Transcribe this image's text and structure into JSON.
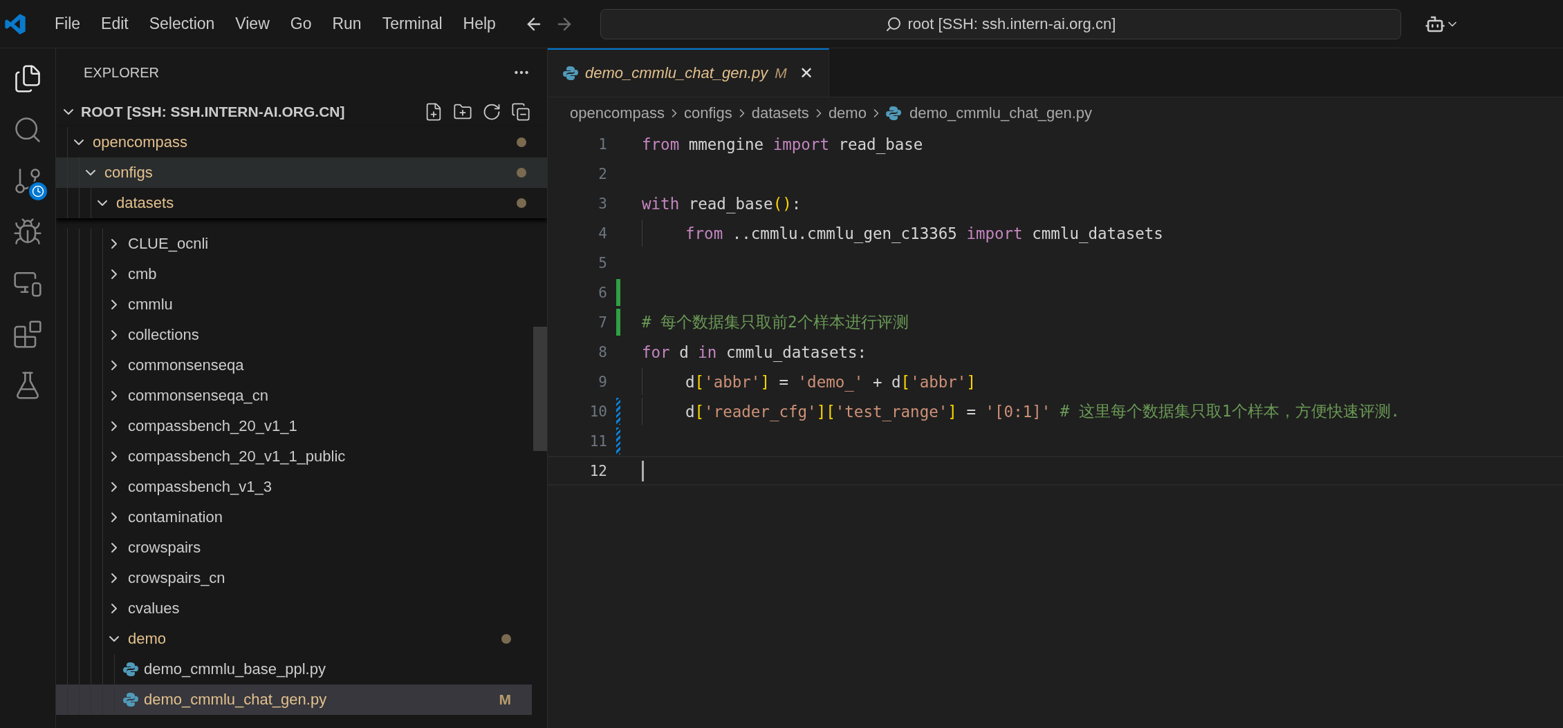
{
  "title_bar": {
    "menu": [
      "File",
      "Edit",
      "Selection",
      "View",
      "Go",
      "Run",
      "Terminal",
      "Help"
    ],
    "nav": [
      {
        "kind": "back",
        "disabled": false
      },
      {
        "kind": "forward",
        "disabled": true
      }
    ],
    "command_center": "root [SSH: ssh.intern-ai.org.cn]"
  },
  "activity_bar": [
    {
      "kind": "explorer",
      "selected": true
    },
    {
      "kind": "search",
      "selected": false
    },
    {
      "kind": "source-control",
      "selected": false
    },
    {
      "kind": "run",
      "selected": false
    },
    {
      "kind": "remote",
      "selected": false
    },
    {
      "kind": "extensions",
      "selected": false
    },
    {
      "kind": "testing",
      "selected": false
    }
  ],
  "sidebar": {
    "title": "EXPLORER",
    "root": "ROOT [SSH: SSH.INTERN-AI.ORG.CN]",
    "tree": [
      {
        "name": "opencompass",
        "kind": "folder",
        "expanded": true,
        "modified": true,
        "hovered": false,
        "selected": false,
        "children": [
          {
            "name": "configs",
            "kind": "folder",
            "expanded": true,
            "modified": true,
            "hovered": true,
            "selected": false,
            "children": [
              {
                "name": "datasets",
                "kind": "folder",
                "expanded": true,
                "modified": true,
                "hovered": false,
                "selected": false,
                "children": [
                  {
                    "name": "CLUE_ocnli",
                    "kind": "folder",
                    "expanded": false,
                    "modified": false,
                    "hovered": false,
                    "selected": false
                  },
                  {
                    "name": "cmb",
                    "kind": "folder",
                    "expanded": false,
                    "modified": false,
                    "hovered": false,
                    "selected": false
                  },
                  {
                    "name": "cmmlu",
                    "kind": "folder",
                    "expanded": false,
                    "modified": false,
                    "hovered": false,
                    "selected": false
                  },
                  {
                    "name": "collections",
                    "kind": "folder",
                    "expanded": false,
                    "modified": false,
                    "hovered": false,
                    "selected": false
                  },
                  {
                    "name": "commonsenseqa",
                    "kind": "folder",
                    "expanded": false,
                    "modified": false,
                    "hovered": false,
                    "selected": false
                  },
                  {
                    "name": "commonsenseqa_cn",
                    "kind": "folder",
                    "expanded": false,
                    "modified": false,
                    "hovered": false,
                    "selected": false
                  },
                  {
                    "name": "compassbench_20_v1_1",
                    "kind": "folder",
                    "expanded": false,
                    "modified": false,
                    "hovered": false,
                    "selected": false
                  },
                  {
                    "name": "compassbench_20_v1_1_public",
                    "kind": "folder",
                    "expanded": false,
                    "modified": false,
                    "hovered": false,
                    "selected": false
                  },
                  {
                    "name": "compassbench_v1_3",
                    "kind": "folder",
                    "expanded": false,
                    "modified": false,
                    "hovered": false,
                    "selected": false
                  },
                  {
                    "name": "contamination",
                    "kind": "folder",
                    "expanded": false,
                    "modified": false,
                    "hovered": false,
                    "selected": false
                  },
                  {
                    "name": "crowspairs",
                    "kind": "folder",
                    "expanded": false,
                    "modified": false,
                    "hovered": false,
                    "selected": false
                  },
                  {
                    "name": "crowspairs_cn",
                    "kind": "folder",
                    "expanded": false,
                    "modified": false,
                    "hovered": false,
                    "selected": false
                  },
                  {
                    "name": "cvalues",
                    "kind": "folder",
                    "expanded": false,
                    "modified": false,
                    "hovered": false,
                    "selected": false
                  },
                  {
                    "name": "demo",
                    "kind": "folder",
                    "expanded": true,
                    "modified": true,
                    "hovered": false,
                    "selected": false,
                    "children": [
                      {
                        "name": "demo_cmmlu_base_ppl.py",
                        "kind": "file",
                        "modified": false,
                        "hovered": false,
                        "selected": false
                      },
                      {
                        "name": "demo_cmmlu_chat_gen.py",
                        "kind": "file",
                        "modified": true,
                        "status": "M",
                        "hovered": false,
                        "selected": true
                      }
                    ]
                  }
                ]
              }
            ]
          }
        ]
      }
    ]
  },
  "editor": {
    "tab": {
      "title": "demo_cmmlu_chat_gen.py",
      "status": "M",
      "close": "✕",
      "selected": true
    },
    "breadcrumb": [
      "opencompass",
      "configs",
      "datasets",
      "demo",
      "demo_cmmlu_chat_gen.py"
    ],
    "lines": [
      {
        "number": "1",
        "current": false,
        "tokens": [
          {
            "kind": "keyword",
            "text": "from"
          },
          {
            "kind": "plain",
            "text": " mmengine "
          },
          {
            "kind": "keyword",
            "text": "import"
          },
          {
            "kind": "plain",
            "text": " read_base"
          }
        ]
      },
      {
        "number": "2",
        "current": false
      },
      {
        "number": "3",
        "current": false,
        "tokens": [
          {
            "kind": "keyword",
            "text": "with"
          },
          {
            "kind": "plain",
            "text": " read_base"
          },
          {
            "kind": "bracket",
            "text": "()"
          },
          {
            "kind": "plain",
            "text": ":"
          }
        ]
      },
      {
        "number": "4",
        "indented": true,
        "current": false,
        "tokens": [
          {
            "kind": "keyword",
            "text": "from"
          },
          {
            "kind": "plain",
            "text": " ..cmmlu.cmmlu_gen_c13365 "
          },
          {
            "kind": "keyword",
            "text": "import"
          },
          {
            "kind": "plain",
            "text": " cmmlu_datasets"
          }
        ]
      },
      {
        "number": "5",
        "current": false
      },
      {
        "number": "6",
        "kind": "added",
        "current": false
      },
      {
        "number": "7",
        "kind": "added",
        "current": false,
        "tokens": [
          {
            "kind": "comment",
            "text": "# 每个数据集只取前2个样本进行评测"
          }
        ]
      },
      {
        "number": "8",
        "current": false,
        "tokens": [
          {
            "kind": "keyword",
            "text": "for"
          },
          {
            "kind": "plain",
            "text": " d "
          },
          {
            "kind": "keyword",
            "text": "in"
          },
          {
            "kind": "plain",
            "text": " cmmlu_datasets:"
          }
        ]
      },
      {
        "number": "9",
        "indented": true,
        "current": false,
        "tokens": [
          {
            "kind": "plain",
            "text": "d"
          },
          {
            "kind": "bracket",
            "text": "["
          },
          {
            "kind": "string",
            "text": "'abbr'"
          },
          {
            "kind": "bracket",
            "text": "]"
          },
          {
            "kind": "plain",
            "text": " = "
          },
          {
            "kind": "string",
            "text": "'demo_'"
          },
          {
            "kind": "plain",
            "text": " + d"
          },
          {
            "kind": "bracket",
            "text": "["
          },
          {
            "kind": "string",
            "text": "'abbr'"
          },
          {
            "kind": "bracket",
            "text": "]"
          }
        ]
      },
      {
        "number": "10",
        "kind": "modified",
        "indented": true,
        "current": false,
        "tokens": [
          {
            "kind": "plain",
            "text": "d"
          },
          {
            "kind": "bracket",
            "text": "["
          },
          {
            "kind": "string",
            "text": "'reader_cfg'"
          },
          {
            "kind": "bracket",
            "text": "]["
          },
          {
            "kind": "string",
            "text": "'test_range'"
          },
          {
            "kind": "bracket",
            "text": "]"
          },
          {
            "kind": "plain",
            "text": " = "
          },
          {
            "kind": "string",
            "text": "'[0:1]'"
          },
          {
            "kind": "comment",
            "text": " # 这里每个数据集只取1个样本，方便快速评测."
          }
        ]
      },
      {
        "number": "11",
        "kind": "modified",
        "current": false
      },
      {
        "number": "12",
        "current": true
      }
    ]
  }
}
